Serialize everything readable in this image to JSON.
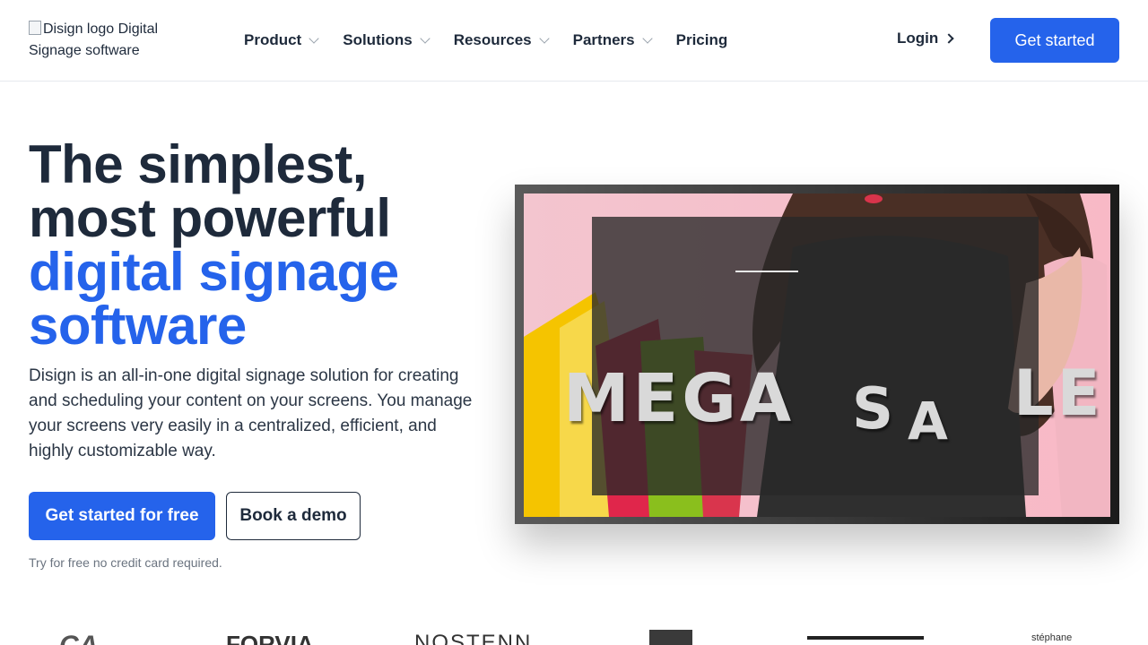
{
  "header": {
    "logo_alt": "Disign logo Digital Signage software",
    "nav": [
      {
        "label": "Product",
        "has_dropdown": true
      },
      {
        "label": "Solutions",
        "has_dropdown": true
      },
      {
        "label": "Resources",
        "has_dropdown": true
      },
      {
        "label": "Partners",
        "has_dropdown": true
      },
      {
        "label": "Pricing",
        "has_dropdown": false
      }
    ],
    "login_label": "Login",
    "cta_label": "Get started"
  },
  "hero": {
    "title_line1": "The simplest,",
    "title_line2": "most powerful",
    "title_line3": "digital signage",
    "title_line4": "software",
    "description": "Disign is an all-in-one digital signage solution for creating and scheduling your content on your screens. You manage your screens very easily in a centralized, efficient, and highly customizable way.",
    "primary_button": "Get started for free",
    "secondary_button": "Book a demo",
    "note": "Try for free no credit card required."
  },
  "screen_mockup": {
    "text_main": "MEGA",
    "text_s": "S",
    "text_a": "A",
    "text_le": "LE"
  },
  "logos": {
    "items": [
      "CA",
      "FORVIA",
      "NOSTENN",
      "",
      "",
      "stéphane"
    ]
  },
  "colors": {
    "brand_blue": "#2563eb",
    "text_dark": "#1e2a3b"
  }
}
